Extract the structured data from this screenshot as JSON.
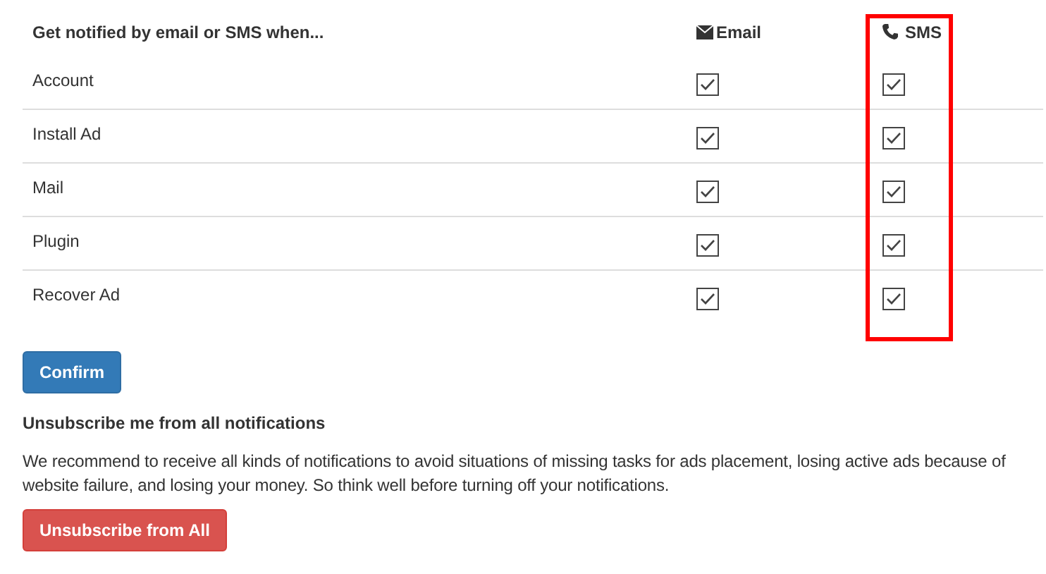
{
  "table": {
    "title": "Get notified by email or SMS when...",
    "columns": [
      {
        "label": "Email",
        "kind": "email",
        "highlighted": false
      },
      {
        "label": "SMS",
        "kind": "sms",
        "highlighted": true
      }
    ],
    "rows": [
      {
        "label": "Account",
        "email": true,
        "sms": true
      },
      {
        "label": "Install Ad",
        "email": true,
        "sms": true
      },
      {
        "label": "Mail",
        "email": true,
        "sms": true
      },
      {
        "label": "Plugin",
        "email": true,
        "sms": true
      },
      {
        "label": "Recover Ad",
        "email": true,
        "sms": true
      }
    ]
  },
  "confirm_button": "Confirm",
  "unsubscribe": {
    "heading": "Unsubscribe me from all notifications",
    "text": "We recommend to receive all kinds of notifications to avoid situations of missing tasks for ads placement, losing active ads because of website failure, and losing your money. So think well before turning off your notifications.",
    "button": "Unsubscribe from All"
  }
}
